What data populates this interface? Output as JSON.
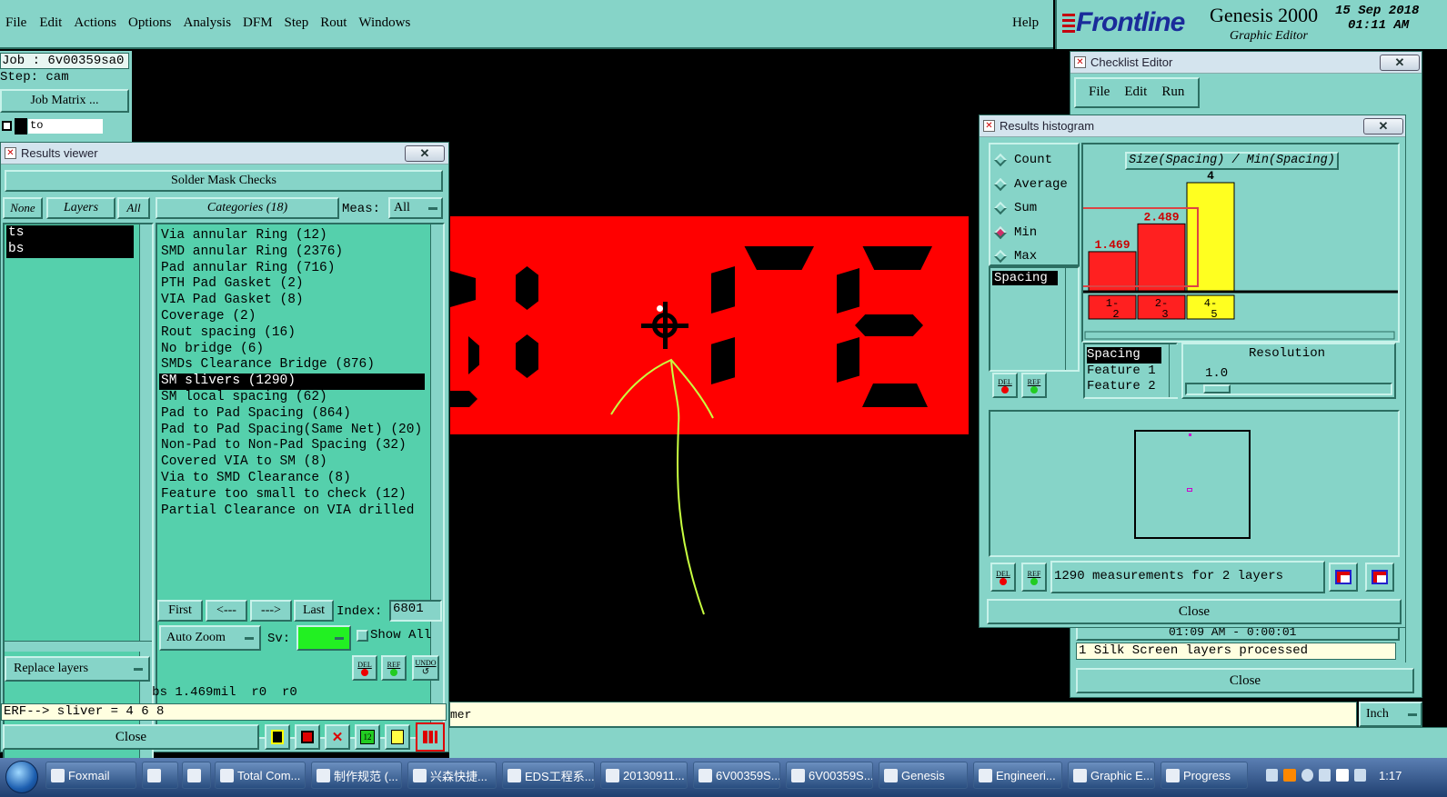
{
  "menubar": {
    "items": [
      "File",
      "Edit",
      "Actions",
      "Options",
      "Analysis",
      "DFM",
      "Step",
      "Rout",
      "Windows"
    ],
    "help": "Help"
  },
  "brand": {
    "logo": "Frontline",
    "product": "Genesis 2000",
    "subtitle": "Graphic Editor",
    "date": "15 Sep 2018",
    "time": "01:11 AM"
  },
  "left_panel": {
    "job": "Job : 6v00359sa0",
    "step": "Step: cam",
    "job_matrix": "Job Matrix ...",
    "layer_label": "to"
  },
  "results_viewer": {
    "title": "Results viewer",
    "header": "Solder Mask Checks",
    "none": "None",
    "layers": "Layers",
    "all": "All",
    "categories": "Categories (18)",
    "meas_label": "Meas:",
    "meas_value": "All",
    "layer_items": [
      "ts",
      "bs"
    ],
    "category_items": [
      "Via annular Ring (12)",
      "SMD annular Ring (2376)",
      "Pad annular Ring (716)",
      "PTH Pad Gasket (2)",
      "VIA Pad Gasket (8)",
      "Coverage (2)",
      "Rout spacing (16)",
      "No bridge (6)",
      "SMDs Clearance Bridge (876)",
      "SM slivers (1290)",
      "SM local spacing (62)",
      "Pad to Pad Spacing (864)",
      "Pad to Pad Spacing(Same Net) (20)",
      "Non-Pad to Non-Pad Spacing (32)",
      "Covered VIA to SM (8)",
      "Via to SMD Clearance (8)",
      "Feature too small to check (12)",
      "Partial Clearance on VIA drilled"
    ],
    "selected_category": 9,
    "first": "First",
    "prev": "<---",
    "next": "--->",
    "last": "Last",
    "index_label": "Index:",
    "index_value": "6801",
    "auto_zoom": "Auto Zoom",
    "sv_label": "Sv:",
    "show_all": "Show All",
    "replace_layers": "Replace layers",
    "del": "DEL",
    "ref": "REF",
    "undo": "UNDO",
    "status": "bs 1.469mil  r0  r0",
    "erf": "ERF--> sliver = 4 6 8",
    "close": "Close"
  },
  "checklist_editor": {
    "title": "Checklist Editor",
    "menu": [
      "File",
      "Edit",
      "Run"
    ],
    "log_time": "01:09 AM - 0:00:01",
    "log_text": "1 Silk Screen layers processed",
    "close": "Close"
  },
  "results_histogram": {
    "title": "Results histogram",
    "modes": [
      "Count",
      "Average",
      "Sum",
      "Min",
      "Max"
    ],
    "selected_mode": "Min",
    "spacing_item": "Spacing",
    "chart_title": "Size(Spacing) / Min(Spacing)",
    "del": "DEL",
    "ref": "REF",
    "attrs": [
      "Spacing",
      "Feature 1",
      "Feature 2"
    ],
    "resolution_label": "Resolution",
    "resolution_value": "1.0",
    "summary": "1290 measurements for 2 layers",
    "close": "Close"
  },
  "chart_data": {
    "type": "bar",
    "title": "Size(Spacing) / Min(Spacing)",
    "categories": [
      "1-\n2",
      "2-\n3",
      "4-\n5"
    ],
    "cat_top": [
      "1-",
      "2-",
      "4-"
    ],
    "cat_bot": [
      "2",
      "3",
      "5"
    ],
    "values": [
      1.469,
      2.489,
      4
    ],
    "labels": [
      "1.469",
      "2.489",
      "4"
    ],
    "colors": [
      "#ff2020",
      "#ff2020",
      "#ffff20"
    ],
    "ylim": [
      0,
      4
    ],
    "grid": false
  },
  "bottom": {
    "prompt_fragment": "mer",
    "units": "Inch"
  },
  "taskbar": {
    "items": [
      "Foxmail",
      "",
      "",
      "Total Com...",
      "制作规范 (...",
      "兴森快捷...",
      "EDS工程系...",
      "20130911...",
      "6V00359S...",
      "6V00359S...",
      "Genesis",
      "Engineeri...",
      "Graphic E...",
      "Progress"
    ],
    "clock": "1:17"
  },
  "colors": {
    "panel": "#86d4c8",
    "list": "#55d0ac",
    "pcb_red": "#ff0000",
    "trace": "#c8ff40"
  }
}
